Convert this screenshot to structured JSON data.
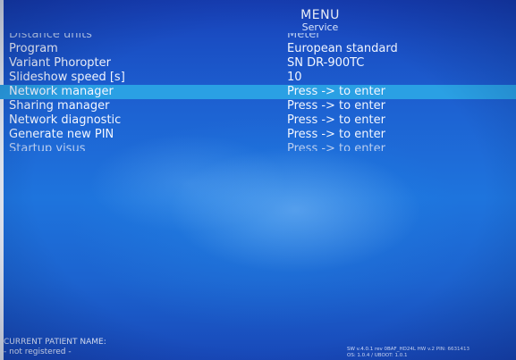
{
  "header": {
    "title": "MENU",
    "subtitle": "Service"
  },
  "menu": {
    "items": [
      {
        "label": "Distance units",
        "value": "Meter"
      },
      {
        "label": "Program",
        "value": "European standard"
      },
      {
        "label": "Variant Phoropter",
        "value": "SN DR-900TC"
      },
      {
        "label": "Slideshow speed [s]",
        "value": "10"
      },
      {
        "label": "Network manager",
        "value": "Press -> to enter"
      },
      {
        "label": "Sharing manager",
        "value": "Press -> to enter"
      },
      {
        "label": "Network diagnostic",
        "value": "Press -> to enter"
      },
      {
        "label": "Generate new PIN",
        "value": "Press -> to enter"
      },
      {
        "label": "Startup visus",
        "value": "Press -> to enter"
      }
    ],
    "selected_index": 4,
    "colors": {
      "background": "#1e6fdb",
      "highlight": "#2aa0e4",
      "text": "#f2f6ff"
    }
  },
  "footer": {
    "patient_label": "CURRENT PATIENT NAME:",
    "patient_value": "- not registered -",
    "version_line1": "SW v.4.0.1 rev 0BAF_HD24L HW v.2 PIN: 6631413",
    "version_line2": "OS: 1.0.4 / UBOOT: 1.0.1"
  }
}
